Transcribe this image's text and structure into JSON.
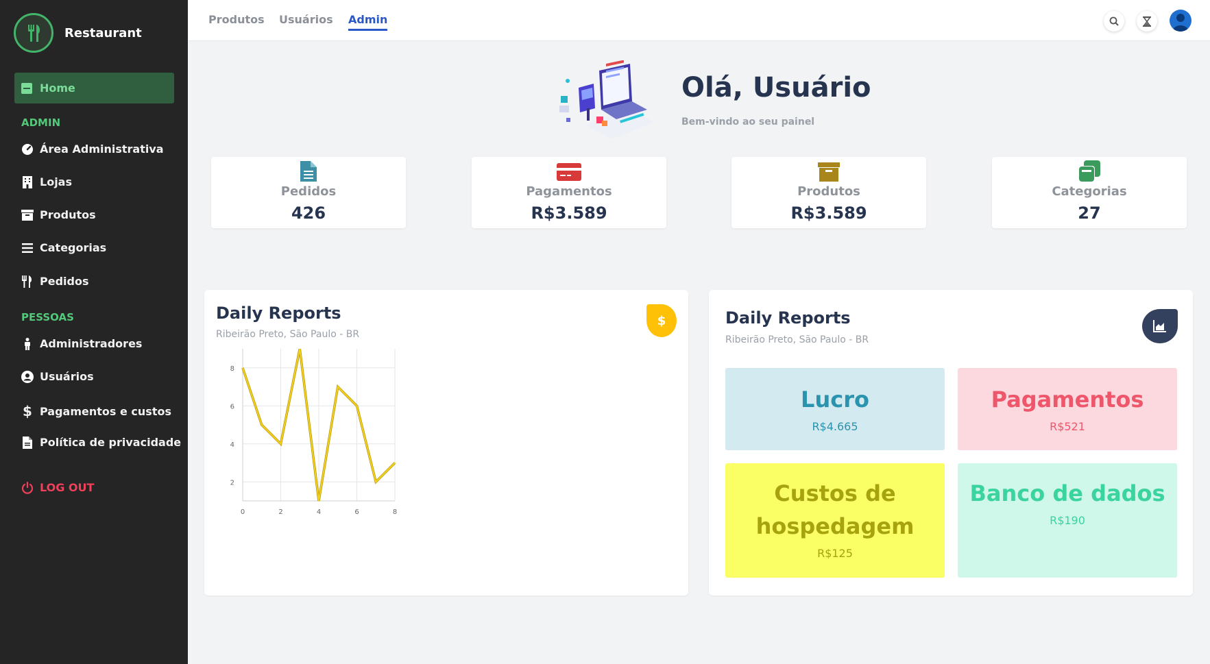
{
  "brand": {
    "name": "Restaurant"
  },
  "sidebar": {
    "home_label": "Home",
    "admin_section": "ADMIN",
    "people_section": "PESSOAS",
    "admin_items": [
      {
        "label": "Área Administrativa",
        "icon": "gauge-icon"
      },
      {
        "label": "Lojas",
        "icon": "building-icon"
      },
      {
        "label": "Produtos",
        "icon": "archive-icon"
      },
      {
        "label": "Categorias",
        "icon": "list-icon"
      },
      {
        "label": "Pedidos",
        "icon": "utensils-icon"
      }
    ],
    "people_items": [
      {
        "label": "Administradores",
        "icon": "person-icon"
      },
      {
        "label": "Usuários",
        "icon": "user-circle-icon"
      },
      {
        "label": "Pagamentos e custos",
        "icon": "dollar-icon"
      },
      {
        "label": "Política de privacidade",
        "icon": "document-icon"
      }
    ],
    "logout_label": "LOG OUT"
  },
  "topbar": {
    "tabs": [
      "Produtos",
      "Usuários",
      "Admin"
    ],
    "active_tab": "Admin"
  },
  "hero": {
    "title": "Olá, Usuário",
    "subtitle": "Bem-vindo ao seu painel"
  },
  "stats": [
    {
      "label": "Pedidos",
      "value": "426",
      "icon": "file-icon",
      "color": "#3d8fa6"
    },
    {
      "label": "Pagamentos",
      "value": "R$3.589",
      "icon": "credit-card-icon",
      "color": "#d83a3a"
    },
    {
      "label": "Produtos",
      "value": "R$3.589",
      "icon": "archive-box-icon",
      "color": "#a8861c"
    },
    {
      "label": "Categorias",
      "value": "27",
      "icon": "copy-icon",
      "color": "#3a9b5c"
    }
  ],
  "report_left": {
    "title": "Daily Reports",
    "subtitle": "Ribeirão Preto, São Paulo - BR",
    "badge_symbol": "$"
  },
  "chart_data": {
    "type": "line",
    "x": [
      0,
      1,
      2,
      3,
      4,
      5,
      6,
      7,
      8
    ],
    "series": [
      {
        "values": [
          8,
          5,
          4,
          9,
          1,
          7,
          6,
          2,
          3
        ],
        "color": "#f5d31b"
      }
    ],
    "xticks": [
      0,
      2,
      4,
      6,
      8
    ],
    "yticks": [
      2,
      4,
      6,
      8
    ],
    "xlim": [
      0,
      8
    ],
    "ylim": [
      1,
      9
    ],
    "grid": true
  },
  "report_right": {
    "title": "Daily Reports",
    "subtitle": "Ribeirão Preto, São Paulo - BR",
    "tiles": [
      {
        "title": "Lucro",
        "value": "R$4.665",
        "bg": "#d3eaf0",
        "fg": "#2a93ad"
      },
      {
        "title": "Pagamentos",
        "value": "R$521",
        "bg": "#fbd9de",
        "fg": "#ee566b"
      },
      {
        "title": "Custos de hospedagem",
        "value": "R$125",
        "bg": "#fbff66",
        "fg": "#a7a310"
      },
      {
        "title": "Banco de dados",
        "value": "R$190",
        "bg": "#cff7ea",
        "fg": "#3bd39e"
      }
    ]
  }
}
